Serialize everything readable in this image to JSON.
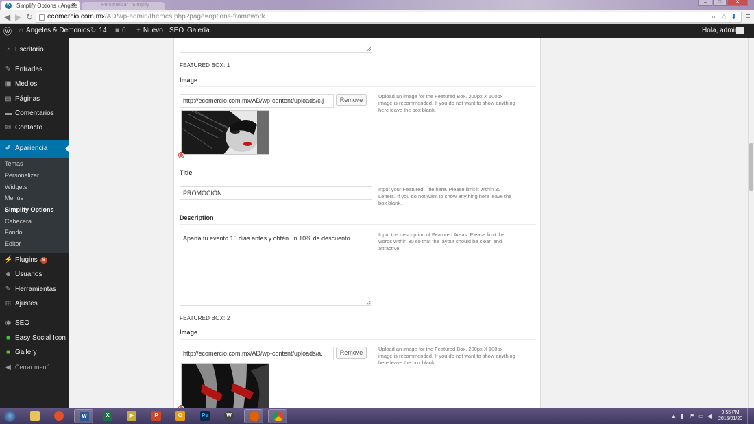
{
  "browser": {
    "tab_title": "Simplify Options ‹ Angele",
    "tab_inactive": "Personalizar · Simplify",
    "url_host": "ecomercio.com.mx",
    "url_path": "/AD/wp-admin/themes.php?page=options-framework"
  },
  "adminbar": {
    "site_name": "Angeles & Demonios",
    "updates_count": "14",
    "comments_count": "0",
    "new_label": "Nuevo",
    "seo_label": "SEO",
    "gallery_label": "Galería",
    "greeting": "Hola, admin"
  },
  "sidebar": {
    "items": [
      {
        "label": "Escritorio",
        "icon": "dashboard-icon"
      },
      {
        "label": "Entradas",
        "icon": "pin-icon"
      },
      {
        "label": "Medios",
        "icon": "media-icon"
      },
      {
        "label": "Páginas",
        "icon": "pages-icon"
      },
      {
        "label": "Comentarios",
        "icon": "comments-icon"
      },
      {
        "label": "Contacto",
        "icon": "contact-icon"
      },
      {
        "label": "Apariencia",
        "icon": "brush-icon"
      },
      {
        "label": "Plugins",
        "icon": "plugin-icon",
        "badge": "8"
      },
      {
        "label": "Usuarios",
        "icon": "users-icon"
      },
      {
        "label": "Herramientas",
        "icon": "tools-icon"
      },
      {
        "label": "Ajustes",
        "icon": "settings-icon"
      },
      {
        "label": "SEO",
        "icon": "seo-icon"
      },
      {
        "label": "Easy Social Icon",
        "icon": "social-icon"
      },
      {
        "label": "Gallery",
        "icon": "gallery-icon"
      },
      {
        "label": "Cerrar menú",
        "icon": "collapse-icon"
      }
    ],
    "submenu": [
      "Temas",
      "Personalizar",
      "Widgets",
      "Menús",
      "Simplify Options",
      "Cabecera",
      "Fondo",
      "Editor"
    ]
  },
  "options": {
    "box1": {
      "heading": "FEATURED BOX: 1",
      "image_label": "Image",
      "image_url": "http://ecomercio.com.mx/AD/wp-content/uploads/c.j",
      "remove_label": "Remove",
      "image_help": "Upload an image for the Featured Box. 200px X 100px image is recommended. If you do not want to show anything here leave the box blank.",
      "title_label": "Title",
      "title_value": "PROMOCIÓN",
      "title_help": "Input your Featured Title here. Please limit it within 30 Letters. If you do not want to show anything here leave the box blank.",
      "desc_label": "Description",
      "desc_value": "Aparta tu evento 15 dias antes y obtén un 10% de descuento.",
      "desc_help": "Input the description of Featured Areas. Please limit the words within 30 so that the layout should be clean and attractive."
    },
    "box2": {
      "heading": "FEATURED BOX: 2",
      "image_label": "Image",
      "image_url": "http://ecomercio.com.mx/AD/wp-content/uploads/a.",
      "remove_label": "Remove",
      "image_help": "Upload an image for the Featured Box. 200px X 100px image is recommended. If you do not want to show anything here leave the box blank."
    }
  },
  "taskbar": {
    "time": "9:55 PM",
    "date": "2015/01/20",
    "apps": [
      "start-orb-icon",
      "explorer-icon",
      "media-center-icon",
      "word-icon",
      "excel-icon",
      "media-player-icon",
      "powerpoint-icon",
      "outlook-icon",
      "photoshop-icon",
      "wordpress-icon",
      "firefox-icon",
      "chrome-icon"
    ]
  }
}
